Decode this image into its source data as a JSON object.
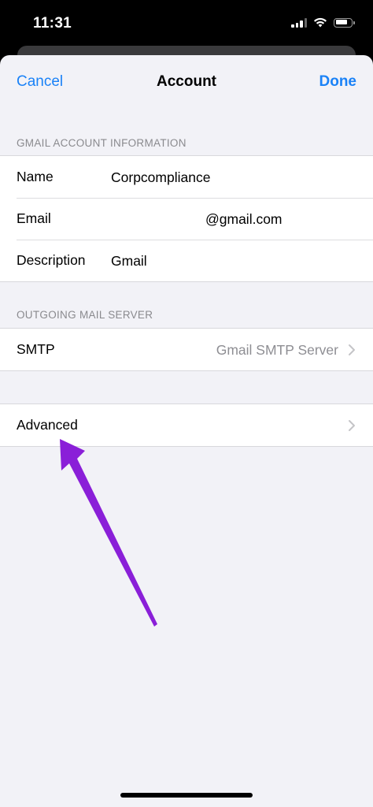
{
  "status_bar": {
    "time": "11:31"
  },
  "nav": {
    "cancel_label": "Cancel",
    "title": "Account",
    "done_label": "Done"
  },
  "account_section": {
    "header": "GMAIL ACCOUNT INFORMATION",
    "rows": [
      {
        "label": "Name",
        "value": "Corpcompliance"
      },
      {
        "label": "Email",
        "value": "@gmail.com"
      },
      {
        "label": "Description",
        "value": "Gmail"
      }
    ]
  },
  "outgoing_section": {
    "header": "OUTGOING MAIL SERVER",
    "smtp_label": "SMTP",
    "smtp_value": "Gmail SMTP Server"
  },
  "advanced": {
    "label": "Advanced"
  },
  "colors": {
    "accent": "#1a82f7",
    "annotation_arrow": "#8a1fd8",
    "background": "#f2f2f7"
  },
  "icons": {
    "chevron": "chevron-right-icon",
    "wifi": "wifi-icon",
    "signal": "cellular-signal-icon",
    "battery": "battery-icon"
  }
}
